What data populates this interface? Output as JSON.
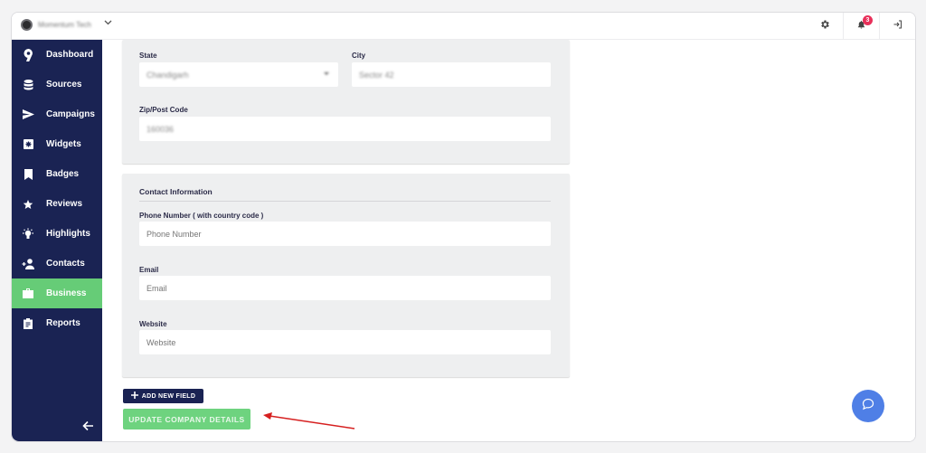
{
  "topbar": {
    "org_name": "Momentum Tech",
    "notification_count": "3",
    "icons": [
      "gear-icon",
      "bell-icon",
      "logout-icon"
    ]
  },
  "sidebar": {
    "items": [
      {
        "label": "Dashboard",
        "icon": "dashboard-icon",
        "active": false
      },
      {
        "label": "Sources",
        "icon": "database-icon",
        "active": false
      },
      {
        "label": "Campaigns",
        "icon": "send-icon",
        "active": false
      },
      {
        "label": "Widgets",
        "icon": "widget-icon",
        "active": false
      },
      {
        "label": "Badges",
        "icon": "bookmark-icon",
        "active": false
      },
      {
        "label": "Reviews",
        "icon": "star-icon",
        "active": false
      },
      {
        "label": "Highlights",
        "icon": "lightbulb-icon",
        "active": false
      },
      {
        "label": "Contacts",
        "icon": "add-contact-icon",
        "active": false
      },
      {
        "label": "Business",
        "icon": "briefcase-icon",
        "active": true
      },
      {
        "label": "Reports",
        "icon": "clipboard-icon",
        "active": false
      }
    ],
    "collapse_icon": "arrow-left-icon"
  },
  "address": {
    "state_label": "State",
    "state_value": "Chandigarh",
    "city_label": "City",
    "city_value": "Sector 42",
    "zip_label": "Zip/Post Code",
    "zip_value": "160036"
  },
  "contact": {
    "title": "Contact Information",
    "phone_label": "Phone Number ( with country code )",
    "phone_placeholder": "Phone Number",
    "email_label": "Email",
    "email_placeholder": "Email",
    "website_label": "Website",
    "website_placeholder": "Website"
  },
  "actions": {
    "add_field_label": "ADD NEW FIELD",
    "update_label": "UPDATE COMPANY DETAILS"
  },
  "colors": {
    "sidebar": "#1a2353",
    "active": "#66cc77",
    "badge": "#e8305a",
    "chat": "#4f7fe6",
    "annotation_arrow": "#d62020"
  }
}
